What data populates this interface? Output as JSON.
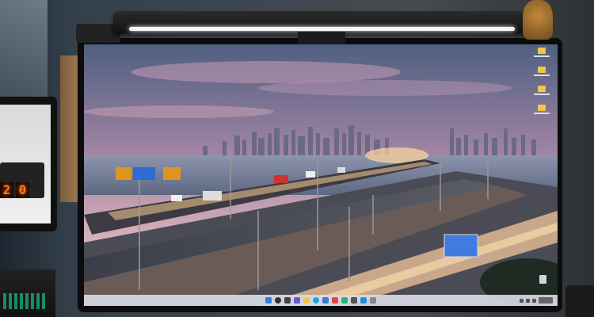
{
  "scene": {
    "left_device_digits": [
      "2",
      "0"
    ]
  },
  "colors": {
    "sky_top": "#5a6a8a",
    "sky_mid": "#b08aa8",
    "sky_horizon": "#d8b3b8",
    "water": "#7b86a0",
    "road_glow": "#ffd28a",
    "nixie_orange": "#ff7a1a"
  },
  "icons": {
    "taskbar": [
      "start-icon",
      "search-icon",
      "taskview-icon",
      "chat-icon",
      "explorer-icon",
      "browser-icon",
      "store-icon",
      "mail-icon",
      "app-icon",
      "app-icon",
      "app-icon",
      "app-icon"
    ],
    "desktop": [
      "folder-icon",
      "folder-icon",
      "folder-icon",
      "folder-icon"
    ]
  }
}
